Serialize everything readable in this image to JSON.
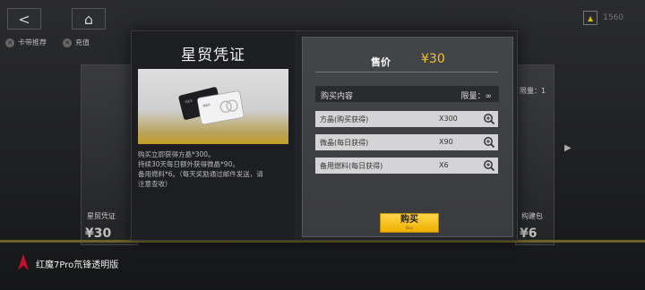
{
  "top": {
    "currency_amount": "1560"
  },
  "tabs": [
    {
      "label": "卡带推荐",
      "icon": "cross-icon"
    },
    {
      "label": "充值",
      "icon": "close-icon"
    }
  ],
  "background": {
    "left_card_caption": "星贸凭证",
    "left_card_price": "¥30",
    "right_card_limit": "限量：1",
    "right_card_caption": "构建包",
    "right_card_price": "¥6"
  },
  "modal": {
    "title": "星贸凭证",
    "description_lines": [
      "购买立即获得方晶*300。",
      "持续30天每日额外获得微晶*90。",
      "备用燃料*6。（每天奖励通过邮件发送，请",
      "注意查收）"
    ],
    "price_label": "售价",
    "price_value": "¥30",
    "contents_header": "购买内容",
    "limit_text": "限量：∞",
    "items": [
      {
        "name": "方晶(购买获得)",
        "qty": "X300"
      },
      {
        "name": "微晶(每日获得)",
        "qty": "X90"
      },
      {
        "name": "备用燃料(每日获得)",
        "qty": "X6"
      }
    ],
    "buy_label": "购买",
    "buy_sublabel": "Buy"
  },
  "brand": {
    "text": "红魔7Pro氘锋透明版"
  },
  "colors": {
    "accent_yellow": "#f0c030",
    "modal_bg": "#222327",
    "buy_button": "#ffd54a"
  }
}
